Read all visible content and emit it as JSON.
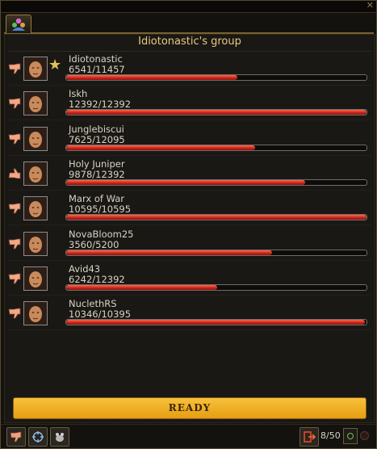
{
  "window": {
    "close_glyph": "✕"
  },
  "tab": {
    "icon": "group-icon"
  },
  "group": {
    "title": "Idiotonastic's group"
  },
  "members": [
    {
      "name": "Idiotonastic",
      "hp": "6541/11457",
      "hp_fraction": 0.571,
      "thumb": "down",
      "leader": true
    },
    {
      "name": "Iskh",
      "hp": "12392/12392",
      "hp_fraction": 1.0,
      "thumb": "down",
      "leader": false
    },
    {
      "name": "Junglebiscui",
      "hp": "7625/12095",
      "hp_fraction": 0.63,
      "thumb": "down",
      "leader": false
    },
    {
      "name": "Holy Juniper",
      "hp": "9878/12392",
      "hp_fraction": 0.797,
      "thumb": "up",
      "leader": false
    },
    {
      "name": "Marx of War",
      "hp": "10595/10595",
      "hp_fraction": 1.0,
      "thumb": "down",
      "leader": false
    },
    {
      "name": "NovaBloom25",
      "hp": "3560/5200",
      "hp_fraction": 0.685,
      "thumb": "down",
      "leader": false
    },
    {
      "name": "Avid43",
      "hp": "6242/12392",
      "hp_fraction": 0.504,
      "thumb": "down",
      "leader": false
    },
    {
      "name": "NuclethRS",
      "hp": "10346/10395",
      "hp_fraction": 0.995,
      "thumb": "down",
      "leader": false
    }
  ],
  "leader_star": "★",
  "ready_button": {
    "label": "READY"
  },
  "footer": {
    "member_count": "8/50",
    "icons": [
      "thumb-down-icon",
      "crosshair-icon",
      "pet-icon",
      "leave-group-icon",
      "status-light-icon"
    ]
  },
  "colors": {
    "accent_gold": "#f2b52e",
    "hp_red": "#d42a1c",
    "title_gold": "#e9c980"
  }
}
